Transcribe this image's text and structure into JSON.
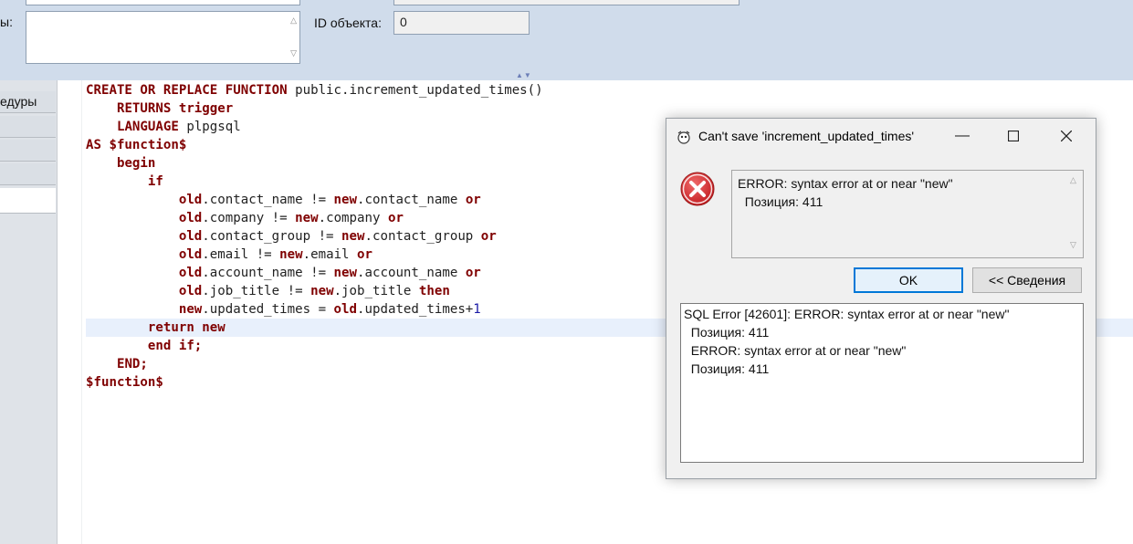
{
  "form": {
    "desc_label": "ы:",
    "id_label": "ID объекта",
    "id_colon": ":",
    "id_value": "0"
  },
  "left_tabs": [
    {
      "label": "едуры"
    },
    {
      "label": ""
    },
    {
      "label": ""
    },
    {
      "label": ""
    },
    {
      "label": ""
    }
  ],
  "editor": {
    "lines": [
      [
        {
          "t": "CREATE OR REPLACE FUNCTION",
          "c": "kw"
        },
        {
          "t": " public.increment_updated_times()",
          "c": "id"
        }
      ],
      [
        {
          "t": "    ",
          "c": "id"
        },
        {
          "t": "RETURNS trigger",
          "c": "kw"
        }
      ],
      [
        {
          "t": "    ",
          "c": "id"
        },
        {
          "t": "LANGUAGE",
          "c": "kw"
        },
        {
          "t": " plpgsql",
          "c": "id"
        }
      ],
      [
        {
          "t": "AS $function$",
          "c": "kw"
        }
      ],
      [
        {
          "t": "    ",
          "c": "id"
        },
        {
          "t": "begin",
          "c": "kw"
        }
      ],
      [
        {
          "t": "        ",
          "c": "id"
        },
        {
          "t": "if",
          "c": "kw"
        }
      ],
      [
        {
          "t": "            ",
          "c": "id"
        },
        {
          "t": "old",
          "c": "kw"
        },
        {
          "t": ".contact_name != ",
          "c": "id"
        },
        {
          "t": "new",
          "c": "kw"
        },
        {
          "t": ".contact_name ",
          "c": "id"
        },
        {
          "t": "or",
          "c": "kw"
        }
      ],
      [
        {
          "t": "            ",
          "c": "id"
        },
        {
          "t": "old",
          "c": "kw"
        },
        {
          "t": ".company != ",
          "c": "id"
        },
        {
          "t": "new",
          "c": "kw"
        },
        {
          "t": ".company ",
          "c": "id"
        },
        {
          "t": "or",
          "c": "kw"
        }
      ],
      [
        {
          "t": "            ",
          "c": "id"
        },
        {
          "t": "old",
          "c": "kw"
        },
        {
          "t": ".contact_group != ",
          "c": "id"
        },
        {
          "t": "new",
          "c": "kw"
        },
        {
          "t": ".contact_group ",
          "c": "id"
        },
        {
          "t": "or",
          "c": "kw"
        }
      ],
      [
        {
          "t": "            ",
          "c": "id"
        },
        {
          "t": "old",
          "c": "kw"
        },
        {
          "t": ".email != ",
          "c": "id"
        },
        {
          "t": "new",
          "c": "kw"
        },
        {
          "t": ".email ",
          "c": "id"
        },
        {
          "t": "or",
          "c": "kw"
        }
      ],
      [
        {
          "t": "            ",
          "c": "id"
        },
        {
          "t": "old",
          "c": "kw"
        },
        {
          "t": ".account_name != ",
          "c": "id"
        },
        {
          "t": "new",
          "c": "kw"
        },
        {
          "t": ".account_name ",
          "c": "id"
        },
        {
          "t": "or",
          "c": "kw"
        }
      ],
      [
        {
          "t": "            ",
          "c": "id"
        },
        {
          "t": "old",
          "c": "kw"
        },
        {
          "t": ".job_title != ",
          "c": "id"
        },
        {
          "t": "new",
          "c": "kw"
        },
        {
          "t": ".job_title ",
          "c": "id"
        },
        {
          "t": "then",
          "c": "kw"
        }
      ],
      [
        {
          "t": "            ",
          "c": "id"
        },
        {
          "t": "new",
          "c": "kw"
        },
        {
          "t": ".updated_times = ",
          "c": "id"
        },
        {
          "t": "old",
          "c": "kw"
        },
        {
          "t": ".updated_times+",
          "c": "id"
        },
        {
          "t": "1",
          "c": "num"
        }
      ],
      [
        {
          "t": "        ",
          "c": "id"
        },
        {
          "t": "return new",
          "c": "kw"
        }
      ],
      [
        {
          "t": "        ",
          "c": "id"
        },
        {
          "t": "end if;",
          "c": "kw"
        }
      ],
      [
        {
          "t": "    ",
          "c": "id"
        },
        {
          "t": "END;",
          "c": "kw"
        }
      ],
      [
        {
          "t": "$function$",
          "c": "kw"
        }
      ]
    ],
    "current_line": 13
  },
  "dialog": {
    "title": "Can't save 'increment_updated_times'",
    "message_line1": "ERROR: syntax error at or near \"new\"",
    "message_line2": "  Позиция: 411",
    "ok_label": "OK",
    "details_label": "<< Сведения",
    "details": [
      "SQL Error [42601]: ERROR: syntax error at or near \"new\"",
      "  Позиция: 411",
      "  ERROR: syntax error at or near \"new\"",
      "  Позиция: 411"
    ]
  },
  "colors": {
    "keyword": "#7f0000",
    "number": "#1a1aa6",
    "panel": "#d0dceb",
    "error_red": "#d9262c",
    "ok_border": "#0078d7"
  }
}
